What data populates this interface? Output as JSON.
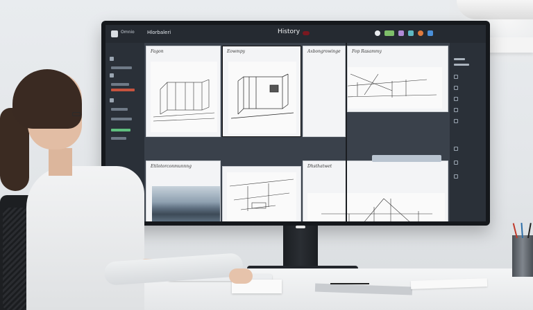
{
  "app": {
    "name": "Omnio",
    "document_title": "Hlorbaleri",
    "history_label": "History"
  },
  "toolbar": {
    "icons": [
      "user-icon",
      "battery-icon",
      "layers-icon",
      "settings-icon",
      "share-icon",
      "profile-icon"
    ]
  },
  "cards": [
    {
      "label": "Fagon"
    },
    {
      "label": "Eowmpy"
    },
    {
      "label": "Axbongrowinge"
    },
    {
      "label": "Fop Rasammy"
    },
    {
      "label": "Etilotorconmunnng"
    },
    {
      "label": "Dhsthatwet"
    }
  ],
  "colors": {
    "screen_bg": "#2c323b",
    "panel_bg": "#2a3038",
    "card_bg": "#f3f4f6",
    "history_indicator": "#7a1820"
  }
}
